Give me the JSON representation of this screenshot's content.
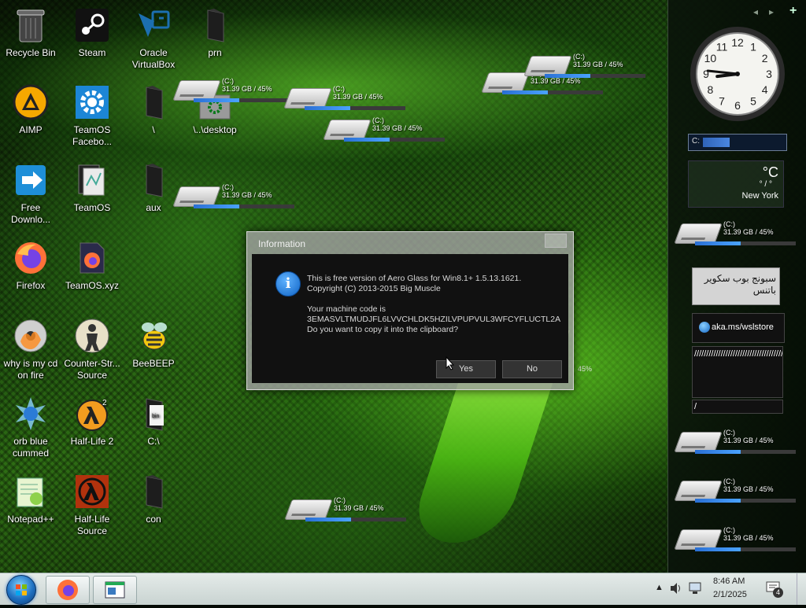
{
  "desktop": {
    "icons": [
      {
        "label": "Recycle Bin"
      },
      {
        "label": "Steam"
      },
      {
        "label": "Oracle VirtualBox"
      },
      {
        "label": "prn"
      },
      {
        "label": "AIMP"
      },
      {
        "label": "TeamOS Facebo..."
      },
      {
        "label": "\\"
      },
      {
        "label": "\\..\\desktop"
      },
      {
        "label": "Free Downlo..."
      },
      {
        "label": "TeamOS"
      },
      {
        "label": "aux"
      },
      {
        "label": "Firefox"
      },
      {
        "label": "TeamOS.xyz"
      },
      {
        "label": "why is my cd on fire"
      },
      {
        "label": "Counter-Str... Source"
      },
      {
        "label": "BeeBEEP"
      },
      {
        "label": "orb blue cummed"
      },
      {
        "label": "Half-Life 2"
      },
      {
        "label": "C:\\"
      },
      {
        "label": "Notepad++"
      },
      {
        "label": "Half-Life Source"
      },
      {
        "label": "con"
      }
    ],
    "drive_widget": {
      "label": "(C:)",
      "info": "31.39 GB / 45%",
      "fraction": 0.45
    },
    "partial_widget_text": "45%"
  },
  "sidebar": {
    "nav": {
      "prev": "◂",
      "next": "▸",
      "add": "+"
    },
    "clock": {
      "numerals": [
        "12",
        "1",
        "2",
        "3",
        "4",
        "5",
        "6",
        "7",
        "8",
        "9",
        "10",
        "11"
      ],
      "hour": 8,
      "minute": 46
    },
    "cpu_label": "C:",
    "weather": {
      "temp": "°C",
      "range": "° / °",
      "city": "New York"
    },
    "drive_widget": {
      "label": "(C:)",
      "info": "31.39 GB / 45%",
      "fraction": 0.45
    },
    "arabic_note": "سبونج بوب سكوير باتنس",
    "link_text": "aka.ms/wslstore",
    "slashes": "//////////////////////////////////////////////////////////////////////////////",
    "slash_field": "/"
  },
  "dialog": {
    "title": "Information",
    "line1": "This is free version of Aero Glass for Win8.1+ 1.5.13.1621.",
    "line2": "Copyright (C) 2013-2015 Big Muscle",
    "line3": "Your machine code is",
    "code": "3EMASVLTMUDJFL6LVVCHLDK5HZILVPUPVUL3WFCYFLUCTL2A",
    "question": "Do you want to copy it into the clipboard?",
    "yes": "Yes",
    "no": "No"
  },
  "taskbar": {
    "time": "8:46 AM",
    "date": "2/1/2025",
    "notification_count": "4"
  }
}
